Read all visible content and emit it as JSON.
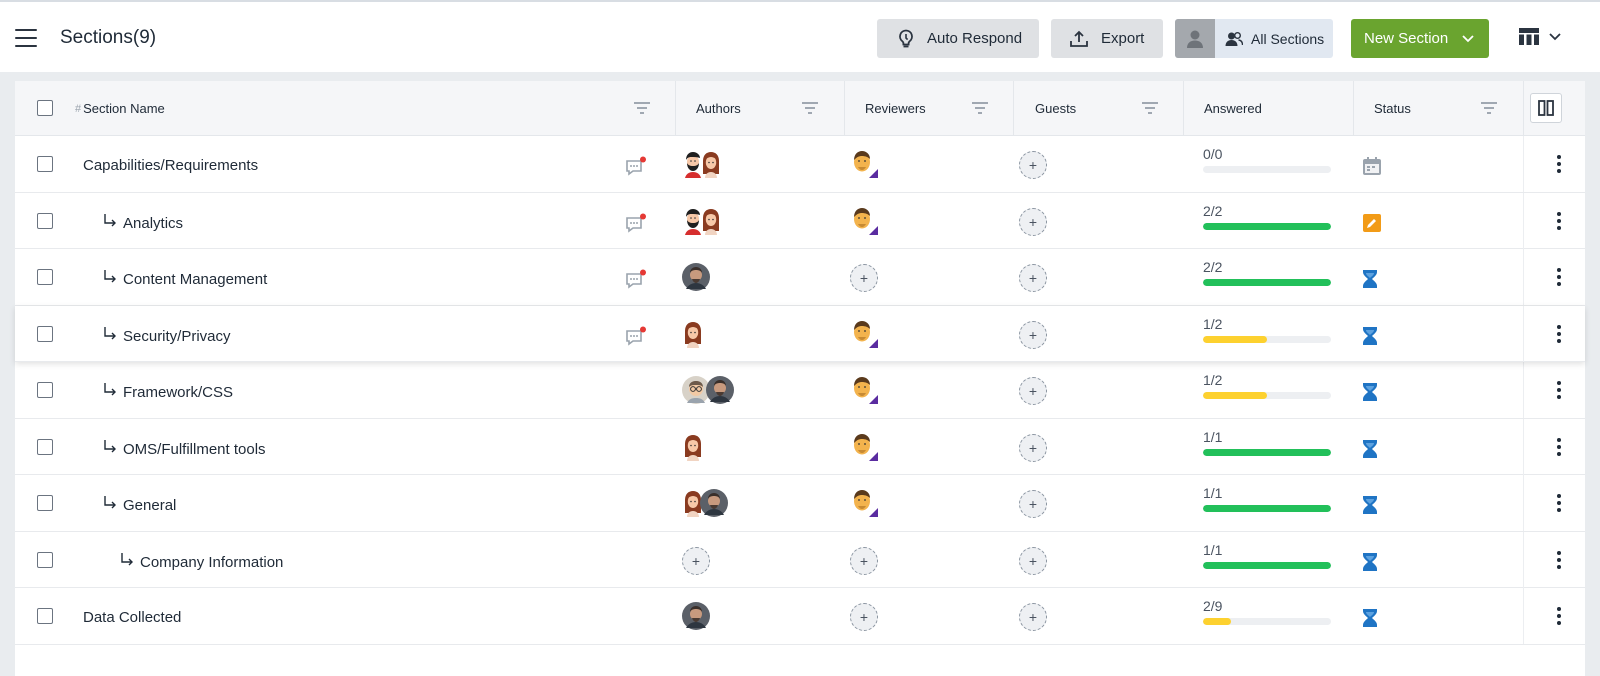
{
  "header": {
    "title": "Sections(9)",
    "auto_respond_label": "Auto Respond",
    "export_label": "Export",
    "all_sections_label": "All Sections",
    "new_section_label": "New Section"
  },
  "table": {
    "columns": {
      "section_name": "Section Name",
      "authors": "Authors",
      "reviewers": "Reviewers",
      "guests": "Guests",
      "answered": "Answered",
      "status": "Status"
    },
    "rows": [
      {
        "name": "Capabilities/Requirements",
        "level": 0,
        "comment": true,
        "authors": [
          "man-beard",
          "woman"
        ],
        "reviewer": "face",
        "answered": "0/0",
        "fraction": 0,
        "bar_color": "#edeff2",
        "status": "calendar-icon",
        "hovered": false
      },
      {
        "name": "Analytics",
        "level": 1,
        "comment": true,
        "authors": [
          "man-beard",
          "woman"
        ],
        "reviewer": "face",
        "answered": "2/2",
        "fraction": 1,
        "bar_color": "#22c05a",
        "status": "edit-icon",
        "hovered": false
      },
      {
        "name": "Content Management",
        "level": 1,
        "comment": true,
        "authors": [
          "photo"
        ],
        "reviewer": "",
        "answered": "2/2",
        "fraction": 1,
        "bar_color": "#22c05a",
        "status": "hourglass-icon",
        "hovered": false
      },
      {
        "name": "Security/Privacy",
        "level": 1,
        "comment": true,
        "authors": [
          "woman"
        ],
        "reviewer": "face",
        "answered": "1/2",
        "fraction": 0.5,
        "bar_color": "#fdd12f",
        "status": "hourglass-icon",
        "hovered": true
      },
      {
        "name": "Framework/CSS",
        "level": 1,
        "comment": false,
        "authors": [
          "glasses",
          "photo"
        ],
        "reviewer": "face",
        "answered": "1/2",
        "fraction": 0.5,
        "bar_color": "#fdd12f",
        "status": "hourglass-icon",
        "hovered": false
      },
      {
        "name": "OMS/Fulfillment tools",
        "level": 1,
        "comment": false,
        "authors": [
          "woman"
        ],
        "reviewer": "face",
        "answered": "1/1",
        "fraction": 1,
        "bar_color": "#22c05a",
        "status": "hourglass-icon",
        "hovered": false
      },
      {
        "name": "General",
        "level": 1,
        "comment": false,
        "authors": [
          "woman",
          "photo"
        ],
        "reviewer": "face",
        "answered": "1/1",
        "fraction": 1,
        "bar_color": "#22c05a",
        "status": "hourglass-icon",
        "hovered": false
      },
      {
        "name": "Company Information",
        "level": 2,
        "comment": false,
        "authors": [],
        "reviewer": "",
        "answered": "1/1",
        "fraction": 1,
        "bar_color": "#22c05a",
        "status": "hourglass-icon",
        "hovered": false
      },
      {
        "name": "Data Collected",
        "level": 0,
        "comment": false,
        "authors": [
          "photo"
        ],
        "reviewer": "",
        "answered": "2/9",
        "fraction": 0.22,
        "bar_color": "#fdd12f",
        "status": "hourglass-icon",
        "hovered": false
      }
    ]
  },
  "colors": {
    "new_section_green": "#6aa42f",
    "progress_green": "#22c05a",
    "progress_yellow": "#fdd12f",
    "status_blue": "#1f74c4",
    "edit_orange": "#f29b17",
    "comment_dot_red": "#e53935"
  }
}
